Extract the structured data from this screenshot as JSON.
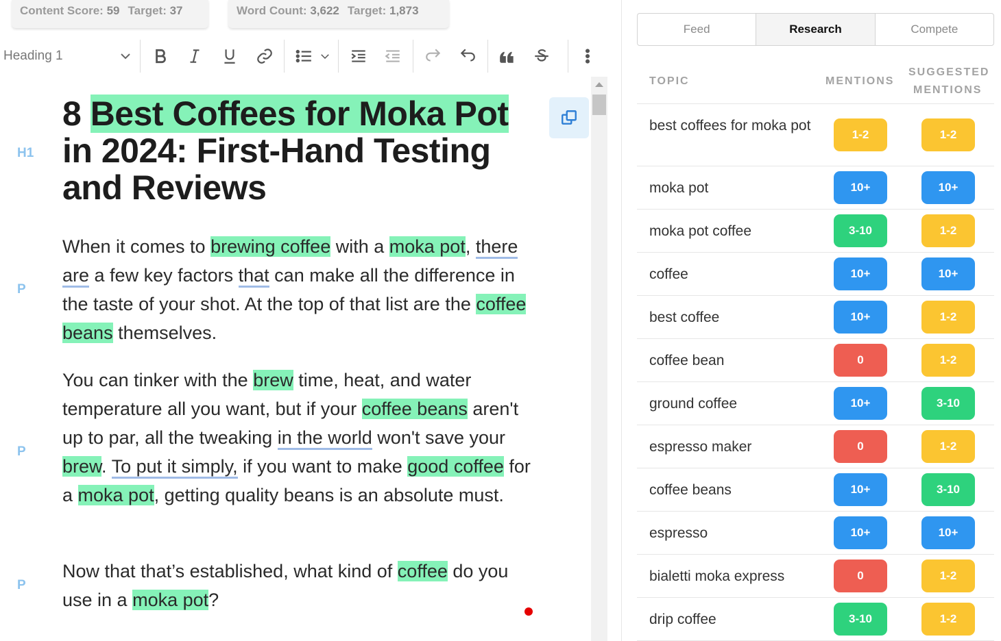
{
  "scores": {
    "content_label": "Content Score:",
    "content_value": "59",
    "content_target_label": "Target:",
    "content_target_value": "37",
    "word_label": "Word Count:",
    "word_value": "3,622",
    "word_target_label": "Target:",
    "word_target_value": "1,873"
  },
  "toolbar": {
    "heading_select": "Heading 1",
    "icons": [
      "bold-icon",
      "italic-icon",
      "underline-icon",
      "link-icon",
      "bullet-list-icon",
      "indent-icon",
      "outdent-icon",
      "redo-icon",
      "undo-icon",
      "quote-icon",
      "strikethrough-icon",
      "more-icon"
    ]
  },
  "editor": {
    "tags": {
      "h1": "H1",
      "p": "P"
    },
    "title": {
      "t1": "8 ",
      "t2": "Best Coffees for Moka Pot",
      "t3": " in 2024: First-Hand Testing and Reviews"
    },
    "p1": {
      "a": "When it comes to ",
      "b": "brewing coffee",
      "c": " with a ",
      "d": "moka pot",
      "e": ",",
      "f": "there are",
      "g": " a few key factors ",
      "h": "that",
      "i": " can make all the difference in the taste of your shot. At the top of that list are the ",
      "j": "coffee beans",
      "k": " themselves."
    },
    "p2": {
      "a": "You can tinker with the ",
      "b": "brew",
      "c": " time, heat, and water temperature all you want, but if your ",
      "d": "coffee beans",
      "e": " aren't up to par, all the tweaking ",
      "f": "in the world",
      "g": " won't save your ",
      "h": "brew",
      "i": ". ",
      "j": "To put it simply,",
      "k": " if you want to make ",
      "l": "good coffee",
      "m": " for a ",
      "n": "moka pot",
      "o": ", getting quality beans is an absolute must."
    },
    "p3": {
      "a": "Now that that’s established, what kind of ",
      "b": "coffee",
      "c": " do you use in a ",
      "d": "moka pot",
      "e": "?"
    }
  },
  "panel": {
    "tabs": [
      "Feed",
      "Research",
      "Compete"
    ],
    "active_tab": "Research",
    "headers": {
      "topic": "TOPIC",
      "mentions": "MENTIONS",
      "suggested_1": "SUGGESTED",
      "suggested_2": "MENTIONS"
    },
    "colors": {
      "yellow": "#fbc531",
      "blue": "#2f96f0",
      "green": "#2ed27d",
      "red": "#ee5e52"
    },
    "rows": [
      {
        "topic": "best coffees for moka pot",
        "mentions": "1-2",
        "m_color": "yellow",
        "suggested": "1-2",
        "s_color": "yellow"
      },
      {
        "topic": "moka pot",
        "mentions": "10+",
        "m_color": "blue",
        "suggested": "10+",
        "s_color": "blue"
      },
      {
        "topic": "moka pot coffee",
        "mentions": "3-10",
        "m_color": "green",
        "suggested": "1-2",
        "s_color": "yellow"
      },
      {
        "topic": "coffee",
        "mentions": "10+",
        "m_color": "blue",
        "suggested": "10+",
        "s_color": "blue"
      },
      {
        "topic": "best coffee",
        "mentions": "10+",
        "m_color": "blue",
        "suggested": "1-2",
        "s_color": "yellow"
      },
      {
        "topic": "coffee bean",
        "mentions": "0",
        "m_color": "red",
        "suggested": "1-2",
        "s_color": "yellow"
      },
      {
        "topic": "ground coffee",
        "mentions": "10+",
        "m_color": "blue",
        "suggested": "3-10",
        "s_color": "green"
      },
      {
        "topic": "espresso maker",
        "mentions": "0",
        "m_color": "red",
        "suggested": "1-2",
        "s_color": "yellow"
      },
      {
        "topic": "coffee beans",
        "mentions": "10+",
        "m_color": "blue",
        "suggested": "3-10",
        "s_color": "green"
      },
      {
        "topic": "espresso",
        "mentions": "10+",
        "m_color": "blue",
        "suggested": "10+",
        "s_color": "blue"
      },
      {
        "topic": "bialetti moka express",
        "mentions": "0",
        "m_color": "red",
        "suggested": "1-2",
        "s_color": "yellow"
      },
      {
        "topic": "drip coffee",
        "mentions": "3-10",
        "m_color": "green",
        "suggested": "1-2",
        "s_color": "yellow"
      }
    ]
  }
}
